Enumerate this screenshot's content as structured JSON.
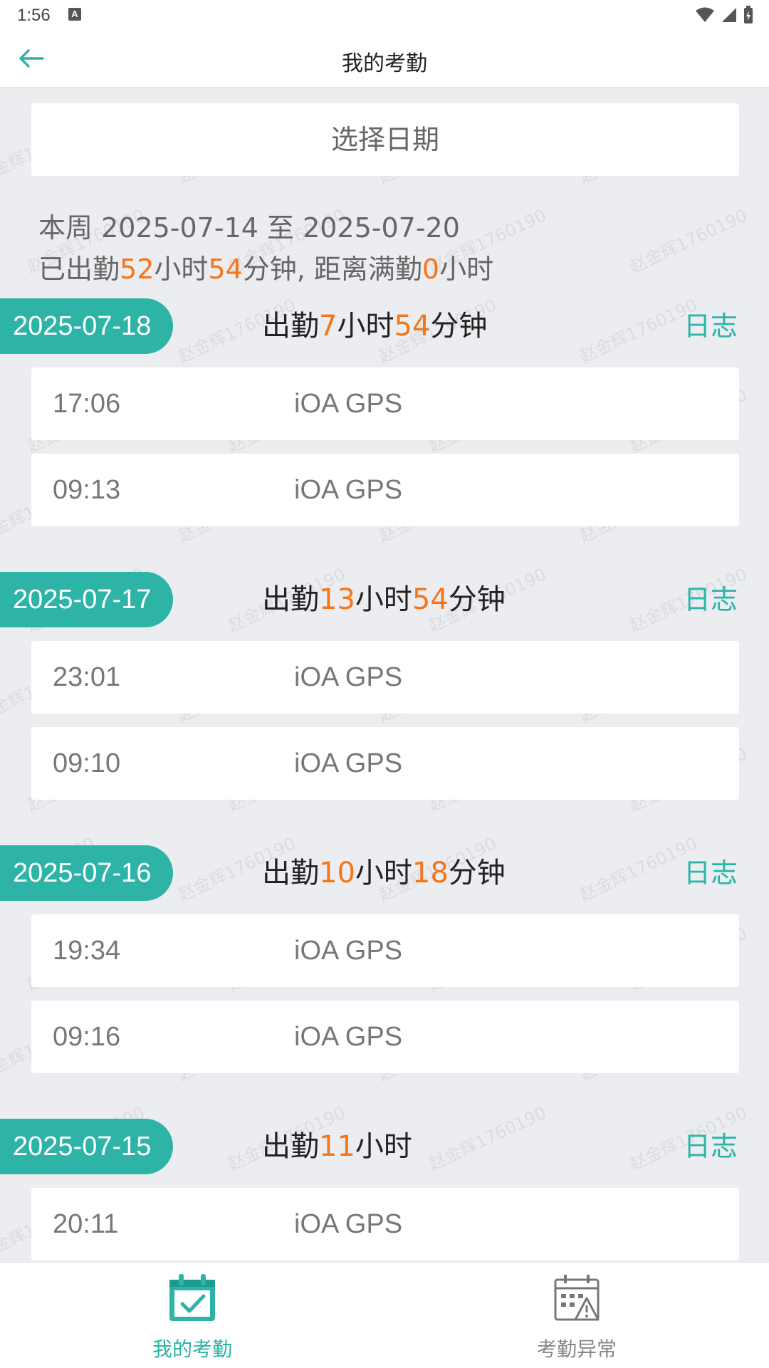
{
  "status_bar": {
    "time": "1:56",
    "a_icon": "A"
  },
  "app_bar": {
    "title": "我的考勤",
    "back_icon": "back-arrow-icon"
  },
  "date_picker": {
    "label": "选择日期"
  },
  "week_summary": {
    "line1": "本周 2025-07-14 至 2025-07-20",
    "prefix": "已出勤",
    "hours": "52",
    "hours_unit": "小时",
    "minutes": "54",
    "minutes_unit": "分钟, 距离满勤",
    "remaining": "0",
    "remaining_unit": "小时"
  },
  "days": [
    {
      "date": "2025-07-18",
      "prefix": "出勤",
      "hours": "7",
      "hours_unit": "小时",
      "minutes": "54",
      "minutes_unit": "分钟",
      "log": "日志",
      "punches": [
        {
          "time": "17:06",
          "source": "iOA GPS"
        },
        {
          "time": "09:13",
          "source": "iOA GPS"
        }
      ]
    },
    {
      "date": "2025-07-17",
      "prefix": "出勤",
      "hours": "13",
      "hours_unit": "小时",
      "minutes": "54",
      "minutes_unit": "分钟",
      "log": "日志",
      "punches": [
        {
          "time": "23:01",
          "source": "iOA GPS"
        },
        {
          "time": "09:10",
          "source": "iOA GPS"
        }
      ]
    },
    {
      "date": "2025-07-16",
      "prefix": "出勤",
      "hours": "10",
      "hours_unit": "小时",
      "minutes": "18",
      "minutes_unit": "分钟",
      "log": "日志",
      "punches": [
        {
          "time": "19:34",
          "source": "iOA GPS"
        },
        {
          "time": "09:16",
          "source": "iOA GPS"
        }
      ]
    },
    {
      "date": "2025-07-15",
      "prefix": "出勤",
      "hours": "11",
      "hours_unit": "小时",
      "minutes": "",
      "minutes_unit": "",
      "log": "日志",
      "punches": [
        {
          "time": "20:11",
          "source": "iOA GPS"
        }
      ]
    }
  ],
  "watermark": "赵金辉1760190",
  "bottom_nav": [
    {
      "label": "我的考勤",
      "icon": "calendar-check-icon",
      "active": true
    },
    {
      "label": "考勤异常",
      "icon": "calendar-warning-icon",
      "active": false
    }
  ],
  "colors": {
    "accent": "#2db4a6",
    "highlight": "#f5761a",
    "background": "#ebedf1",
    "inactive": "#888888"
  }
}
